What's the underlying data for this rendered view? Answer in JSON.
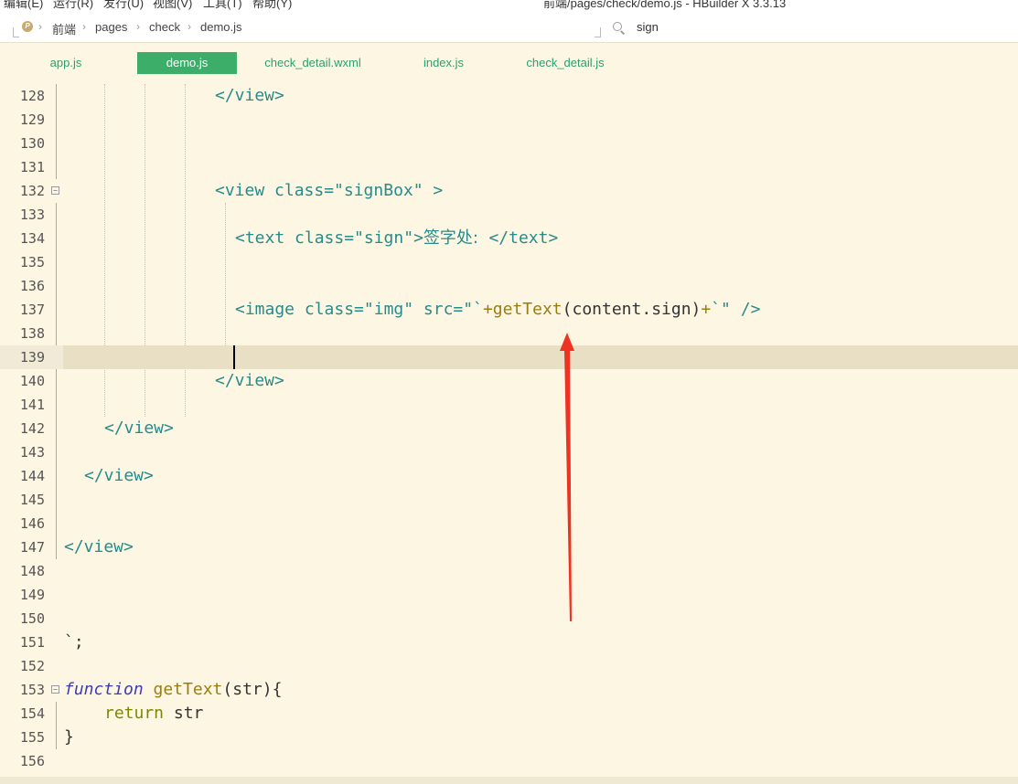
{
  "menubar": {
    "items": [
      "编辑(E)",
      "运行(R)",
      "发行(U)",
      "视图(V)",
      "工具(T)",
      "帮助(Y)"
    ],
    "window_title": "前端/pages/check/demo.js - HBuilder X 3.3.13"
  },
  "breadcrumb": {
    "items": [
      "前端",
      "pages",
      "check",
      "demo.js"
    ]
  },
  "search": {
    "value": "sign"
  },
  "tabs": [
    {
      "label": "app.js",
      "active": false
    },
    {
      "label": "demo.js",
      "active": true
    },
    {
      "label": "check_detail.wxml",
      "active": false
    },
    {
      "label": "index.js",
      "active": false
    },
    {
      "label": "check_detail.js",
      "active": false
    }
  ],
  "editor": {
    "line_numbers": [
      "128",
      "129",
      "130",
      "131",
      "132",
      "133",
      "134",
      "135",
      "136",
      "137",
      "138",
      "139",
      "140",
      "141",
      "142",
      "143",
      "144",
      "145",
      "146",
      "147",
      "148",
      "149",
      "150",
      "151",
      "152",
      "153",
      "154",
      "155",
      "156"
    ],
    "code": {
      "l128": "</view>",
      "l132a": "<view class=",
      "l132b": "\"signBox\"",
      "l132c": " >",
      "l134a": "<text class=",
      "l134b": "\"sign\"",
      "l134c": ">",
      "l134d": "签字处:  ",
      "l134e": "</text>",
      "l137a": "<image class=",
      "l137b": "\"img\"",
      "l137c": " src=",
      "l137d": "\"`",
      "l137e": "+getText",
      "l137f": "(content.sign)",
      "l137g": "+",
      "l137h": "`\" />",
      "l140": "</view>",
      "l142": "</view>",
      "l144": "</view>",
      "l147": "</view>",
      "l151": "`;",
      "l153a": "function",
      "l153b": " getText",
      "l153c": "(str){",
      "l154a": "return",
      "l154b": " str",
      "l155": "}"
    }
  },
  "colors": {
    "background": "#fdf6e3",
    "tag": "#268b8b",
    "active_tab": "#3cae6a",
    "annotation_arrow": "#ee3322"
  }
}
